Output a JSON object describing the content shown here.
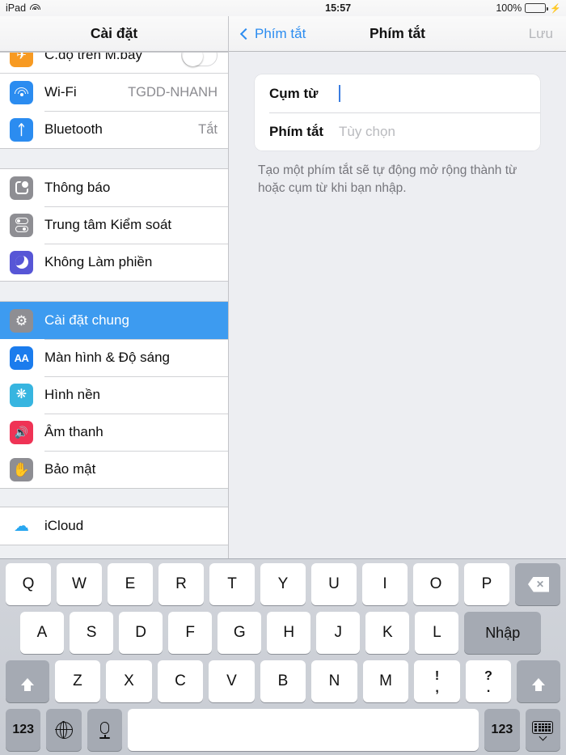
{
  "status_bar": {
    "device": "iPad",
    "wifi_icon": "wifi-icon",
    "time": "15:57",
    "battery_percent": "100%",
    "charging_icon": "lightning-bolt-icon"
  },
  "sidebar": {
    "title": "Cài đặt",
    "groups": [
      {
        "rows": [
          {
            "label": "C.độ trên M.bay",
            "icon": "airplane-icon",
            "value": "",
            "control": "toggle-off",
            "partial": true
          },
          {
            "label": "Wi-Fi",
            "icon": "wifi-icon",
            "value": "TGDD-NHANH"
          },
          {
            "label": "Bluetooth",
            "icon": "bluetooth-icon",
            "value": "Tắt"
          }
        ]
      },
      {
        "rows": [
          {
            "label": "Thông báo",
            "icon": "notifications-icon",
            "value": ""
          },
          {
            "label": "Trung tâm Kiểm soát",
            "icon": "control-center-icon",
            "value": ""
          },
          {
            "label": "Không Làm phiền",
            "icon": "moon-icon",
            "value": ""
          }
        ]
      },
      {
        "rows": [
          {
            "label": "Cài đặt chung",
            "icon": "gear-icon",
            "value": "",
            "selected": true
          },
          {
            "label": "Màn hình & Độ sáng",
            "icon": "display-brightness-icon",
            "value": ""
          },
          {
            "label": "Hình nền",
            "icon": "wallpaper-icon",
            "value": ""
          },
          {
            "label": "Âm thanh",
            "icon": "speaker-icon",
            "value": ""
          },
          {
            "label": "Bảo mật",
            "icon": "hand-privacy-icon",
            "value": ""
          }
        ]
      },
      {
        "rows": [
          {
            "label": "iCloud",
            "icon": "icloud-icon",
            "value": ""
          }
        ]
      }
    ]
  },
  "detail": {
    "back_label": "Phím tắt",
    "title": "Phím tắt",
    "save_label": "Lưu",
    "fields": [
      {
        "label": "Cụm từ",
        "value": "",
        "placeholder": "",
        "focused": true
      },
      {
        "label": "Phím tắt",
        "value": "",
        "placeholder": "Tùy chọn",
        "focused": false
      }
    ],
    "note": "Tạo một phím tắt sẽ tự động mở rộng thành từ hoặc cụm từ khi bạn nhập."
  },
  "keyboard": {
    "row1": [
      "Q",
      "W",
      "E",
      "R",
      "T",
      "Y",
      "U",
      "I",
      "O",
      "P"
    ],
    "backspace_icon": "backspace-icon",
    "row2": [
      "A",
      "S",
      "D",
      "F",
      "G",
      "H",
      "J",
      "K",
      "L"
    ],
    "enter_label": "Nhập",
    "shift_icon": "shift-arrow-icon",
    "row3": [
      "Z",
      "X",
      "C",
      "V",
      "B",
      "N",
      "M"
    ],
    "punct1_top": "!",
    "punct1_bottom": ",",
    "punct2_top": "?",
    "punct2_bottom": ".",
    "numeric_left_label": "123",
    "globe_icon": "globe-icon",
    "mic_icon": "microphone-icon",
    "space_label": "",
    "numeric_right_label": "123",
    "hide_keyboard_icon": "hide-keyboard-icon"
  },
  "colors": {
    "accent_blue": "#2b8cf0",
    "selection_blue": "#3d9bf0",
    "battery_green": "#4cd551",
    "airplane_orange": "#f79a22",
    "dnd_purple": "#5756d6",
    "sound_red": "#ef3355",
    "gray_icon": "#8e8e93"
  }
}
